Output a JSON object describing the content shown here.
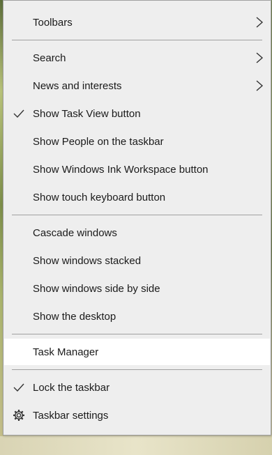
{
  "menu": {
    "items": [
      {
        "label": "Toolbars",
        "submenu": true
      },
      {
        "label": "Search",
        "submenu": true
      },
      {
        "label": "News and interests",
        "submenu": true
      },
      {
        "label": "Show Task View button",
        "checked": true
      },
      {
        "label": "Show People on the taskbar"
      },
      {
        "label": "Show Windows Ink Workspace button"
      },
      {
        "label": "Show touch keyboard button"
      },
      {
        "label": "Cascade windows"
      },
      {
        "label": "Show windows stacked"
      },
      {
        "label": "Show windows side by side"
      },
      {
        "label": "Show the desktop"
      },
      {
        "label": "Task Manager",
        "highlighted": true
      },
      {
        "label": "Lock the taskbar",
        "checked": true
      },
      {
        "label": "Taskbar settings",
        "icon": "gear-icon"
      }
    ]
  },
  "colors": {
    "menu_background": "#eeeeee",
    "highlight": "#ffffff",
    "separator": "#a0a0a0",
    "text": "#1a1a1a"
  }
}
